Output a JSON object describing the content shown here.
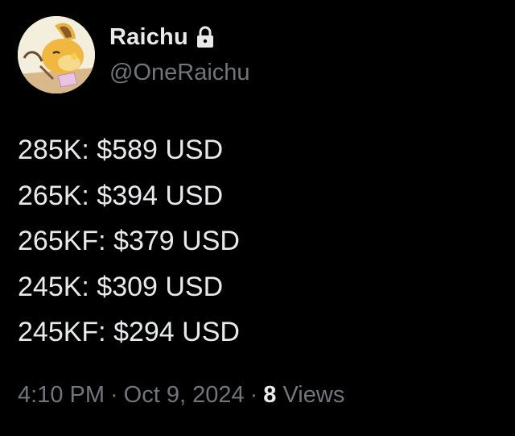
{
  "author": {
    "display_name": "Raichu",
    "handle": "@OneRaichu",
    "avatar_icon": "raichu-avatar-icon",
    "protected_icon": "lock-icon"
  },
  "tweet": {
    "lines": [
      "285K: $589 USD",
      "265K: $394 USD",
      "265KF: $379 USD",
      "245K: $309 USD",
      "245KF: $294 USD"
    ]
  },
  "meta": {
    "time": "4:10 PM",
    "date": "Oct 9, 2024",
    "separator": "·",
    "views_count": "8",
    "views_label": "Views"
  },
  "colors": {
    "background": "#000000",
    "primary_text": "#e7e9ea",
    "secondary_text": "#71767b"
  }
}
